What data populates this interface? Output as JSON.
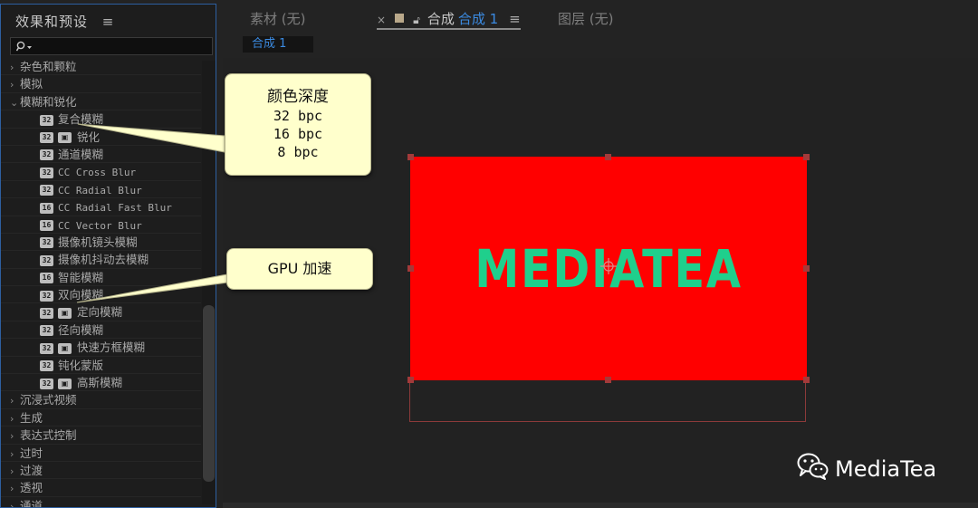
{
  "left_panel": {
    "title": "效果和预设",
    "menu_icon": "≡",
    "search": {
      "value": "",
      "placeholder": ""
    },
    "categories_before": [
      {
        "label": "杂色和颗粒",
        "expanded": false
      },
      {
        "label": "模拟",
        "expanded": false
      }
    ],
    "open_category": {
      "label": "模糊和锐化",
      "expanded": true
    },
    "effects": [
      {
        "label": "复合模糊",
        "bpc": "32",
        "gpu": false,
        "mono": false
      },
      {
        "label": "锐化",
        "bpc": "32",
        "gpu": true,
        "mono": false
      },
      {
        "label": "通道模糊",
        "bpc": "32",
        "gpu": false,
        "mono": false
      },
      {
        "label": "CC Cross Blur",
        "bpc": "32",
        "gpu": false,
        "mono": true
      },
      {
        "label": "CC Radial Blur",
        "bpc": "32",
        "gpu": false,
        "mono": true
      },
      {
        "label": "CC Radial Fast Blur",
        "bpc": "16",
        "gpu": false,
        "mono": true
      },
      {
        "label": "CC Vector Blur",
        "bpc": "16",
        "gpu": false,
        "mono": true
      },
      {
        "label": "摄像机镜头模糊",
        "bpc": "32",
        "gpu": false,
        "mono": false
      },
      {
        "label": "摄像机抖动去模糊",
        "bpc": "32",
        "gpu": false,
        "mono": false
      },
      {
        "label": "智能模糊",
        "bpc": "16",
        "gpu": false,
        "mono": false
      },
      {
        "label": "双向模糊",
        "bpc": "32",
        "gpu": false,
        "mono": false
      },
      {
        "label": "定向模糊",
        "bpc": "32",
        "gpu": true,
        "mono": false
      },
      {
        "label": "径向模糊",
        "bpc": "32",
        "gpu": false,
        "mono": false
      },
      {
        "label": "快速方框模糊",
        "bpc": "32",
        "gpu": true,
        "mono": false
      },
      {
        "label": "钝化蒙版",
        "bpc": "32",
        "gpu": false,
        "mono": false
      },
      {
        "label": "高斯模糊",
        "bpc": "32",
        "gpu": true,
        "mono": false
      }
    ],
    "categories_after": [
      {
        "label": "沉浸式视频",
        "expanded": false
      },
      {
        "label": "生成",
        "expanded": false
      },
      {
        "label": "表达式控制",
        "expanded": false
      },
      {
        "label": "过时",
        "expanded": false
      },
      {
        "label": "过渡",
        "expanded": false
      },
      {
        "label": "透视",
        "expanded": false
      },
      {
        "label": "通道",
        "expanded": false
      }
    ]
  },
  "tabs": {
    "footage": "素材 (无)",
    "comp_prefix": "合成",
    "comp_name": "合成 1",
    "layer": "图层 (无)",
    "close_symbol": "×",
    "menu_symbol": "≡"
  },
  "viewer": {
    "sub_tab": "合成 1",
    "canvas_text": "MEDIATEA",
    "canvas_color": "#ff0000",
    "text_color": "#1fcf8c"
  },
  "callouts": {
    "depth_title": "颜色深度",
    "depth_lines": [
      "32 bpc",
      "16 bpc",
      "8 bpc"
    ],
    "gpu": "GPU 加速"
  },
  "watermark": "MediaTea",
  "colors": {
    "accent": "#3b8be2",
    "panel_border": "#2d5fa0",
    "callout_bg": "#ffffcc"
  }
}
